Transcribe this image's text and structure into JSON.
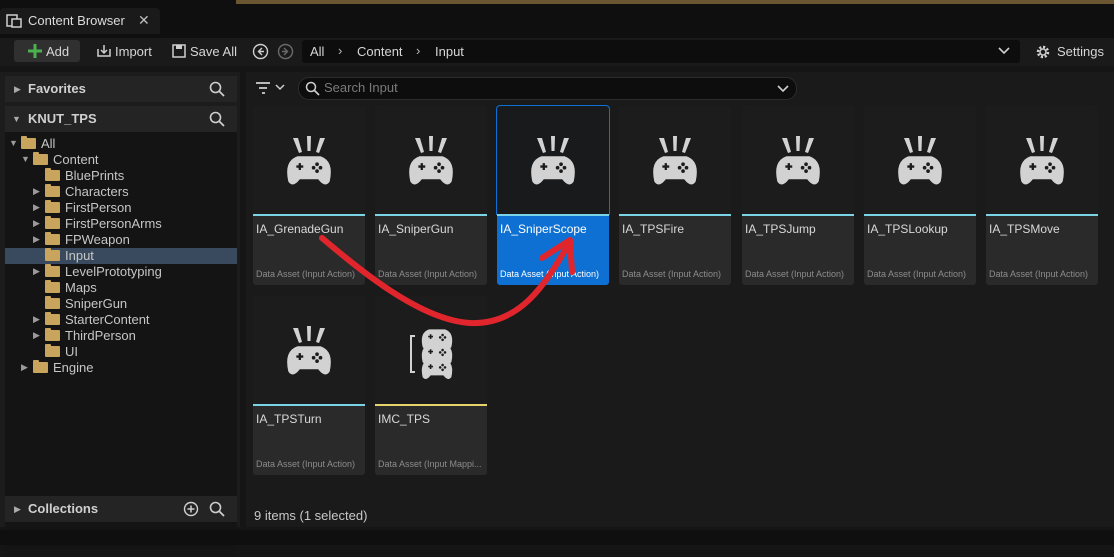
{
  "tab": {
    "title": "Content Browser",
    "close": "✕"
  },
  "toolbar": {
    "add": "Add",
    "import": "Import",
    "save_all": "Save All",
    "settings": "Settings"
  },
  "breadcrumb": [
    "All",
    "Content",
    "Input"
  ],
  "left": {
    "favorites": "Favorites",
    "project": "KNUT_TPS",
    "collections": "Collections",
    "tree": [
      {
        "label": "All",
        "expanded": true
      },
      {
        "label": "Content",
        "expanded": true
      },
      {
        "label": "BluePrints"
      },
      {
        "label": "Characters",
        "expanded": false
      },
      {
        "label": "FirstPerson",
        "expanded": false
      },
      {
        "label": "FirstPersonArms",
        "expanded": false
      },
      {
        "label": "FPWeapon",
        "expanded": false
      },
      {
        "label": "Input",
        "selected": true
      },
      {
        "label": "LevelPrototyping",
        "expanded": false
      },
      {
        "label": "Maps"
      },
      {
        "label": "SniperGun"
      },
      {
        "label": "StarterContent",
        "expanded": false
      },
      {
        "label": "ThirdPerson",
        "expanded": false
      },
      {
        "label": "UI"
      },
      {
        "label": "Engine",
        "expanded": false
      }
    ]
  },
  "search": {
    "placeholder": "Search Input"
  },
  "assets": [
    {
      "name": "IA_GrenadeGun",
      "type": "Data Asset (Input Action)"
    },
    {
      "name": "IA_SniperGun",
      "type": "Data Asset (Input Action)"
    },
    {
      "name": "IA_SniperScope",
      "type": "Data Asset (Input Action)",
      "selected": true
    },
    {
      "name": "IA_TPSFire",
      "type": "Data Asset (Input Action)"
    },
    {
      "name": "IA_TPSJump",
      "type": "Data Asset (Input Action)"
    },
    {
      "name": "IA_TPSLookup",
      "type": "Data Asset (Input Action)"
    },
    {
      "name": "IA_TPSMove",
      "type": "Data Asset (Input Action)"
    },
    {
      "name": "IA_TPSTurn",
      "type": "Data Asset (Input Action)"
    },
    {
      "name": "IMC_TPS",
      "type": "Data Asset (Input Mappi..."
    }
  ],
  "status": "9 items (1 selected)",
  "colors": {
    "accent": "#0e70d2",
    "action_bar": "#7ad4e6",
    "mapping_bar": "#e6d36a",
    "annotation": "#e0262c",
    "folder": "#c9a45c",
    "add_icon": "#4caf50"
  },
  "icons": [
    "content-browser-icon",
    "close-icon",
    "plus-icon",
    "import-icon",
    "save-icon",
    "back-icon",
    "forward-icon",
    "chevron-down-icon",
    "gear-icon",
    "search-icon",
    "filter-icon",
    "folder-icon",
    "gamepad-icon",
    "add-circle-icon"
  ]
}
